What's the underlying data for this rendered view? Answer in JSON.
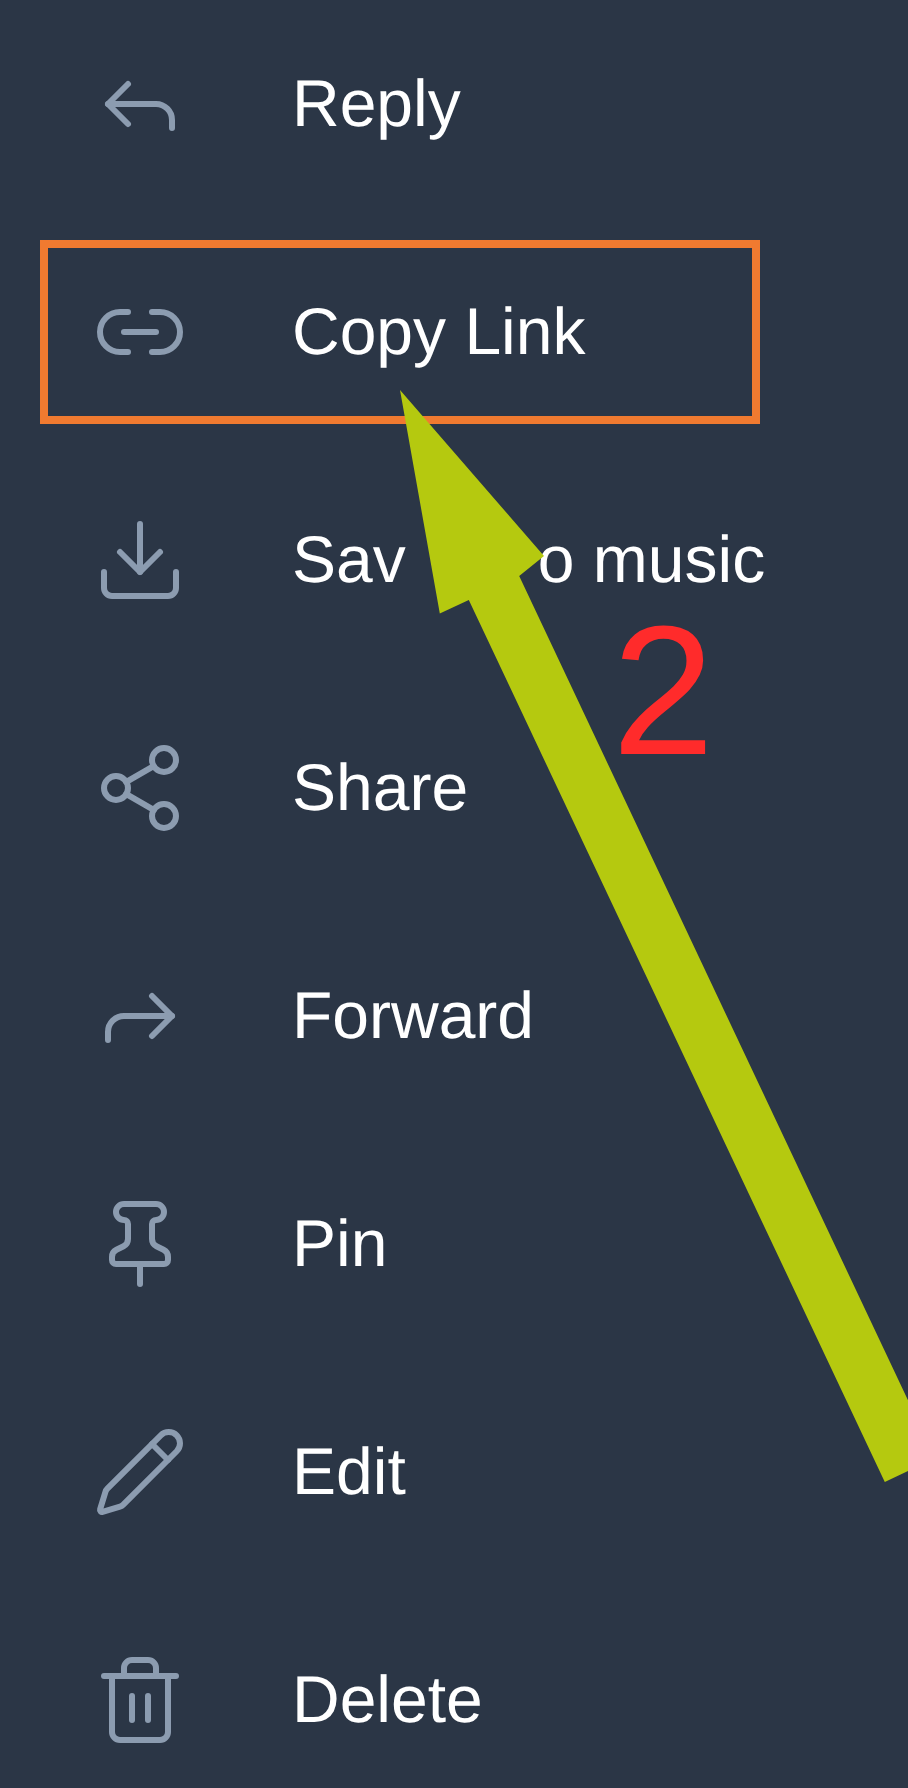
{
  "menu": {
    "items": [
      {
        "kind": "reply",
        "label": "Reply",
        "highlighted": false
      },
      {
        "kind": "link",
        "label": "Copy Link",
        "highlighted": true
      },
      {
        "kind": "download",
        "label": "Sav",
        "label_continued": "o music",
        "highlighted": false
      },
      {
        "kind": "share",
        "label": "Share",
        "highlighted": false
      },
      {
        "kind": "forward",
        "label": "Forward",
        "highlighted": false
      },
      {
        "kind": "pin",
        "label": "Pin",
        "highlighted": false
      },
      {
        "kind": "edit",
        "label": "Edit",
        "highlighted": false
      },
      {
        "kind": "delete",
        "label": "Delete",
        "highlighted": false
      }
    ]
  },
  "annotation": {
    "step_number": "2"
  }
}
